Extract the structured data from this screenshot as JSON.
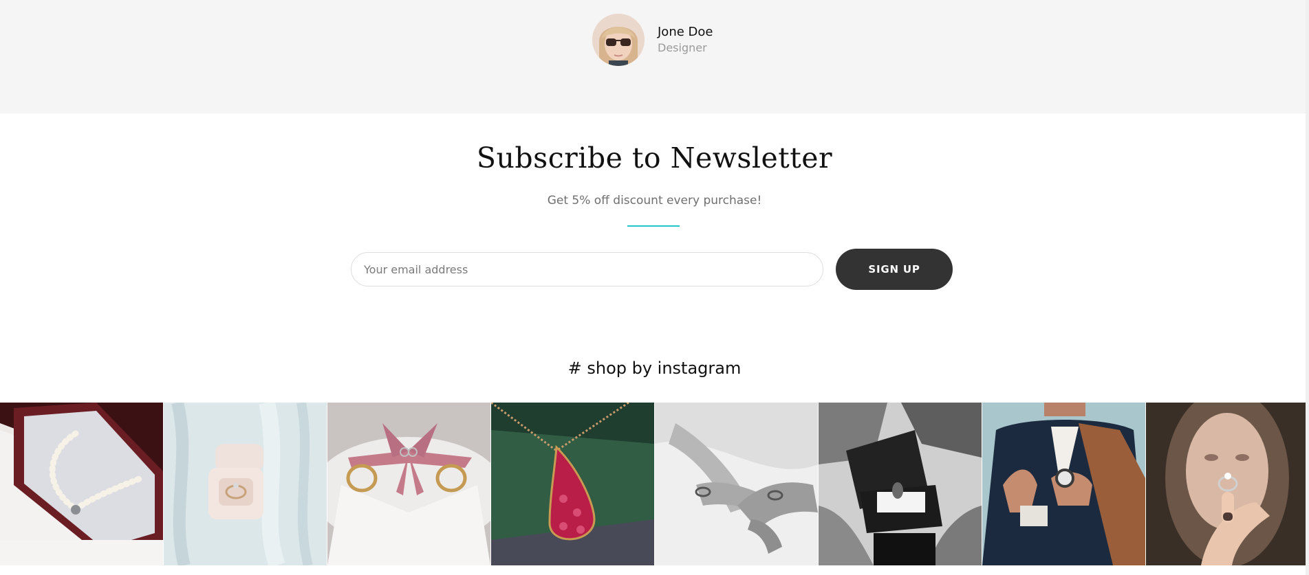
{
  "testimonial": {
    "author_name": "Jone Doe",
    "author_role": "Designer"
  },
  "newsletter": {
    "title": "Subscribe to Newsletter",
    "subtitle": "Get 5% off discount every purchase!",
    "email_placeholder": "Your email address",
    "email_value": "",
    "signup_label": "SIGN UP"
  },
  "instagram": {
    "heading": "# shop by instagram",
    "items": [
      {
        "icon": "pearl-necklace-photo"
      },
      {
        "icon": "ring-box-photo"
      },
      {
        "icon": "wedding-rings-ribbon-photo"
      },
      {
        "icon": "ruby-pendant-photo"
      },
      {
        "icon": "hands-with-rings-photo"
      },
      {
        "icon": "ring-box-proposal-photo"
      },
      {
        "icon": "man-with-watch-photo"
      },
      {
        "icon": "woman-showing-ring-photo"
      }
    ]
  },
  "colors": {
    "accent": "#22c5c8",
    "button": "#333333",
    "strip_bg": "#f5f5f5"
  }
}
